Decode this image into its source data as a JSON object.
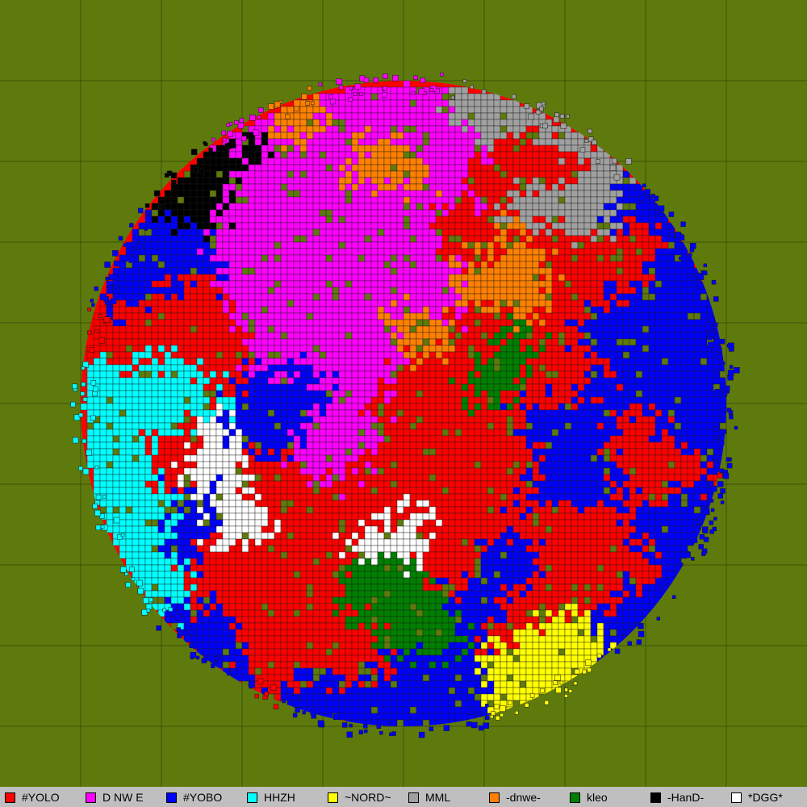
{
  "map": {
    "background_color": "#5f7a0c",
    "grid_color": "#3d5208",
    "territory_border_color": "#1a1a1a",
    "legend_background": "#bfbfbf"
  },
  "legend": [
    {
      "name": "#YOLO",
      "color": "#ff0000"
    },
    {
      "name": "D NW E",
      "color": "#ff00ff"
    },
    {
      "name": "#YOBO",
      "color": "#0000ff"
    },
    {
      "name": "HHZH",
      "color": "#00ffff"
    },
    {
      "name": "~NORD~",
      "color": "#ffff00"
    },
    {
      "name": "MML",
      "color": "#a0a0a0"
    },
    {
      "name": "-dnwe-",
      "color": "#ff8000"
    },
    {
      "name": "kleo",
      "color": "#008000"
    },
    {
      "name": "-HanD-",
      "color": "#000000"
    },
    {
      "name": "*DGG*",
      "color": "#ffffff"
    }
  ]
}
